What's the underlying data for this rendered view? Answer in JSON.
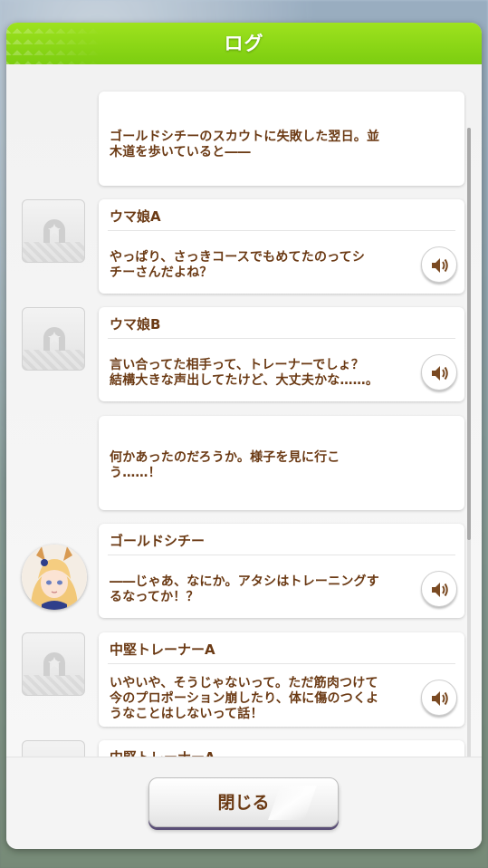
{
  "header": {
    "title": "ログ"
  },
  "entries": [
    {
      "speaker": "",
      "lines": [
        "ゴールドシチーのスカウトに失敗した翌日。並",
        "木道を歩いていると――"
      ]
    },
    {
      "speaker": "ウマ娘A",
      "lines": [
        "やっぱり、さっきコースでもめてたのってシ",
        "チーさんだよね？"
      ]
    },
    {
      "speaker": "ウマ娘B",
      "lines": [
        "言い合ってた相手って、トレーナーでしょ？",
        "結構大きな声出してたけど、大丈夫かな……。"
      ]
    },
    {
      "speaker": "",
      "lines": [
        "何かあったのだろうか。様子を見に行こ",
        "う……！"
      ]
    },
    {
      "speaker": "ゴールドシチー",
      "lines": [
        "――じゃあ、なにか。アタシはトレーニングす",
        "るなってか！？"
      ]
    },
    {
      "speaker": "中堅トレーナーA",
      "lines": [
        "いやいや、そうじゃないって。ただ筋肉つけて",
        "今のプロポーション崩したり、体に傷のつくよ",
        "うなことはしないって話！"
      ]
    },
    {
      "speaker": "中堅トレーナーA",
      "lines": [
        ""
      ]
    }
  ],
  "footer": {
    "close_label": "閉じる"
  },
  "icons": {
    "placeholder_avatar": "horseshoe-star-icon",
    "voice": "speaker-icon"
  },
  "colors": {
    "header_green": "#8ad616",
    "text_brown": "#6b3a14",
    "button_shadow": "#5a4e76"
  }
}
